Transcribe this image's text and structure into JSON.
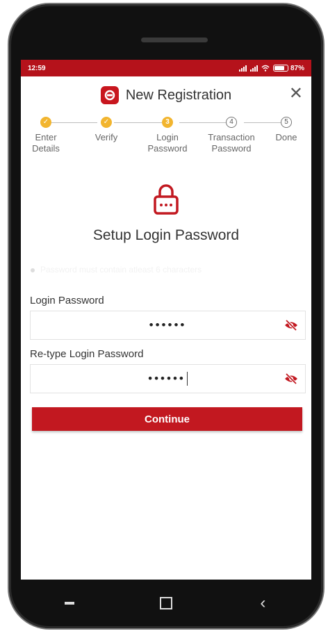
{
  "status": {
    "time": "12:59",
    "battery": "87%",
    "battery_level": 0.87
  },
  "header": {
    "title": "New Registration"
  },
  "steps": [
    {
      "label_line1": "Enter",
      "label_line2": "Details",
      "state": "done"
    },
    {
      "label_line1": "Verify",
      "label_line2": "",
      "state": "done"
    },
    {
      "label_line1": "Login",
      "label_line2": "Password",
      "state": "active",
      "number": "3"
    },
    {
      "label_line1": "Transaction",
      "label_line2": "Password",
      "state": "todo",
      "number": "4"
    },
    {
      "label_line1": "Done",
      "label_line2": "",
      "state": "todo",
      "number": "5"
    }
  ],
  "main": {
    "title": "Setup Login Password",
    "hint": "Password must contain atleast 6 characters"
  },
  "form": {
    "login_label": "Login Password",
    "login_value": "••••••",
    "retype_label": "Re-type Login Password",
    "retype_value": "••••••"
  },
  "actions": {
    "continue_label": "Continue"
  },
  "colors": {
    "accent": "#c21820",
    "step": "#f2b52f"
  }
}
